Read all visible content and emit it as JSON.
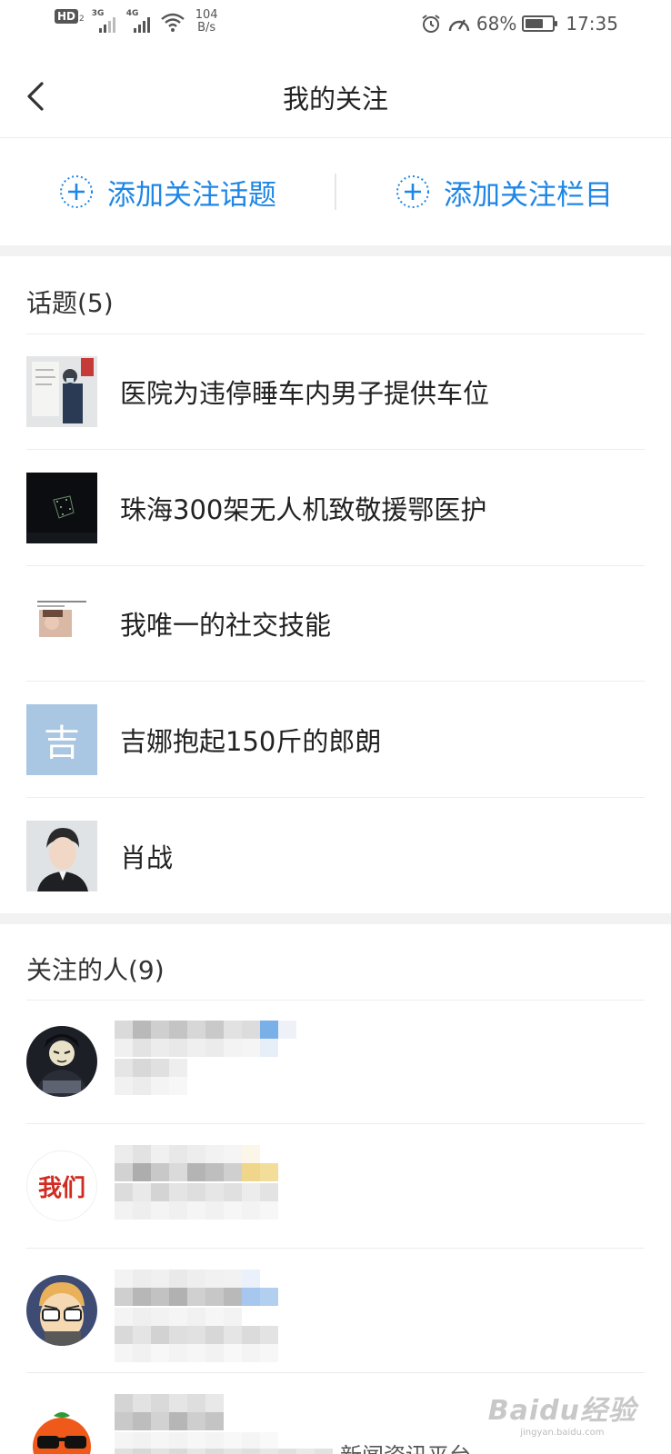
{
  "status_bar": {
    "hd_label": "HD",
    "hd_sub": "2",
    "net1": "3G",
    "net2": "4G",
    "speed_value": "104",
    "speed_unit": "B/s",
    "battery_percent": "68%",
    "battery_level": 0.68,
    "time": "17:35",
    "icons": [
      "alarm-icon",
      "speedometer-icon",
      "wifi-icon",
      "battery-icon"
    ]
  },
  "header": {
    "title": "我的关注"
  },
  "actions": {
    "add_topic_label": "添加关注话题",
    "add_column_label": "添加关注栏目"
  },
  "topics": {
    "heading": "话题(5)",
    "items": [
      {
        "label": "医院为违停睡车内男子提供车位"
      },
      {
        "label": "珠海300架无人机致敬援鄂医护"
      },
      {
        "label": "我唯一的社交技能"
      },
      {
        "label": "吉娜抱起150斤的郎朗",
        "thumb_char": "吉"
      },
      {
        "label": "肖战"
      }
    ]
  },
  "people": {
    "heading": "关注的人(9)",
    "partial_text": "新闻资讯平台",
    "avatar_text_2": "我们"
  },
  "watermark": {
    "logo": "Baidu经验",
    "url": "jingyan.baidu.com"
  },
  "colors": {
    "accent": "#1e86e6",
    "divider": "#ececec",
    "section_gap": "#f2f2f2"
  }
}
